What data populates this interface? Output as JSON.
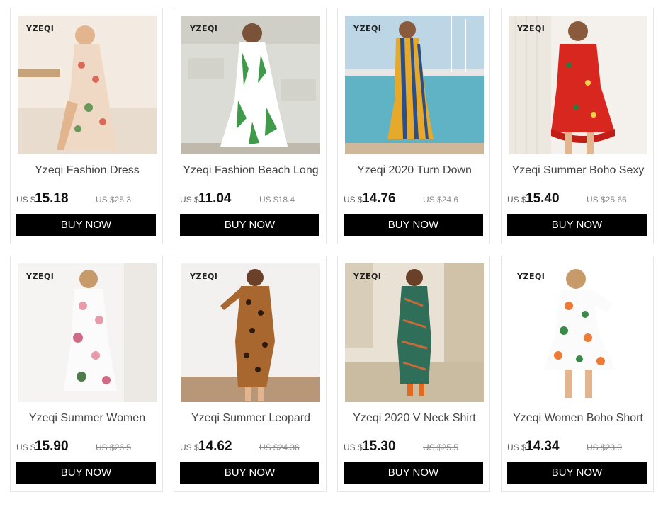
{
  "brand_logo": "YZEQI",
  "buy_label": "BUY NOW",
  "products": [
    {
      "title": "Yzeqi Fashion Dress",
      "currency": "US $",
      "price": "15.18",
      "old_price": "US $25.3"
    },
    {
      "title": "Yzeqi Fashion Beach Long",
      "currency": "US $",
      "price": "11.04",
      "old_price": "US $18.4"
    },
    {
      "title": "Yzeqi 2020 Turn Down",
      "currency": "US $",
      "price": "14.76",
      "old_price": "US $24.6"
    },
    {
      "title": "Yzeqi Summer Boho Sexy",
      "currency": "US $",
      "price": "15.40",
      "old_price": "US $25.66"
    },
    {
      "title": "Yzeqi Summer Women",
      "currency": "US $",
      "price": "15.90",
      "old_price": "US $26.5"
    },
    {
      "title": "Yzeqi Summer Leopard",
      "currency": "US $",
      "price": "14.62",
      "old_price": "US $24.36"
    },
    {
      "title": "Yzeqi 2020 V Neck Shirt",
      "currency": "US $",
      "price": "15.30",
      "old_price": "US $25.5"
    },
    {
      "title": "Yzeqi Women Boho Short",
      "currency": "US $",
      "price": "14.34",
      "old_price": "US $23.9"
    }
  ],
  "colors": {
    "button_bg": "#000000",
    "button_text": "#ffffff",
    "card_border": "#e6e6e6",
    "old_price": "#888888"
  }
}
